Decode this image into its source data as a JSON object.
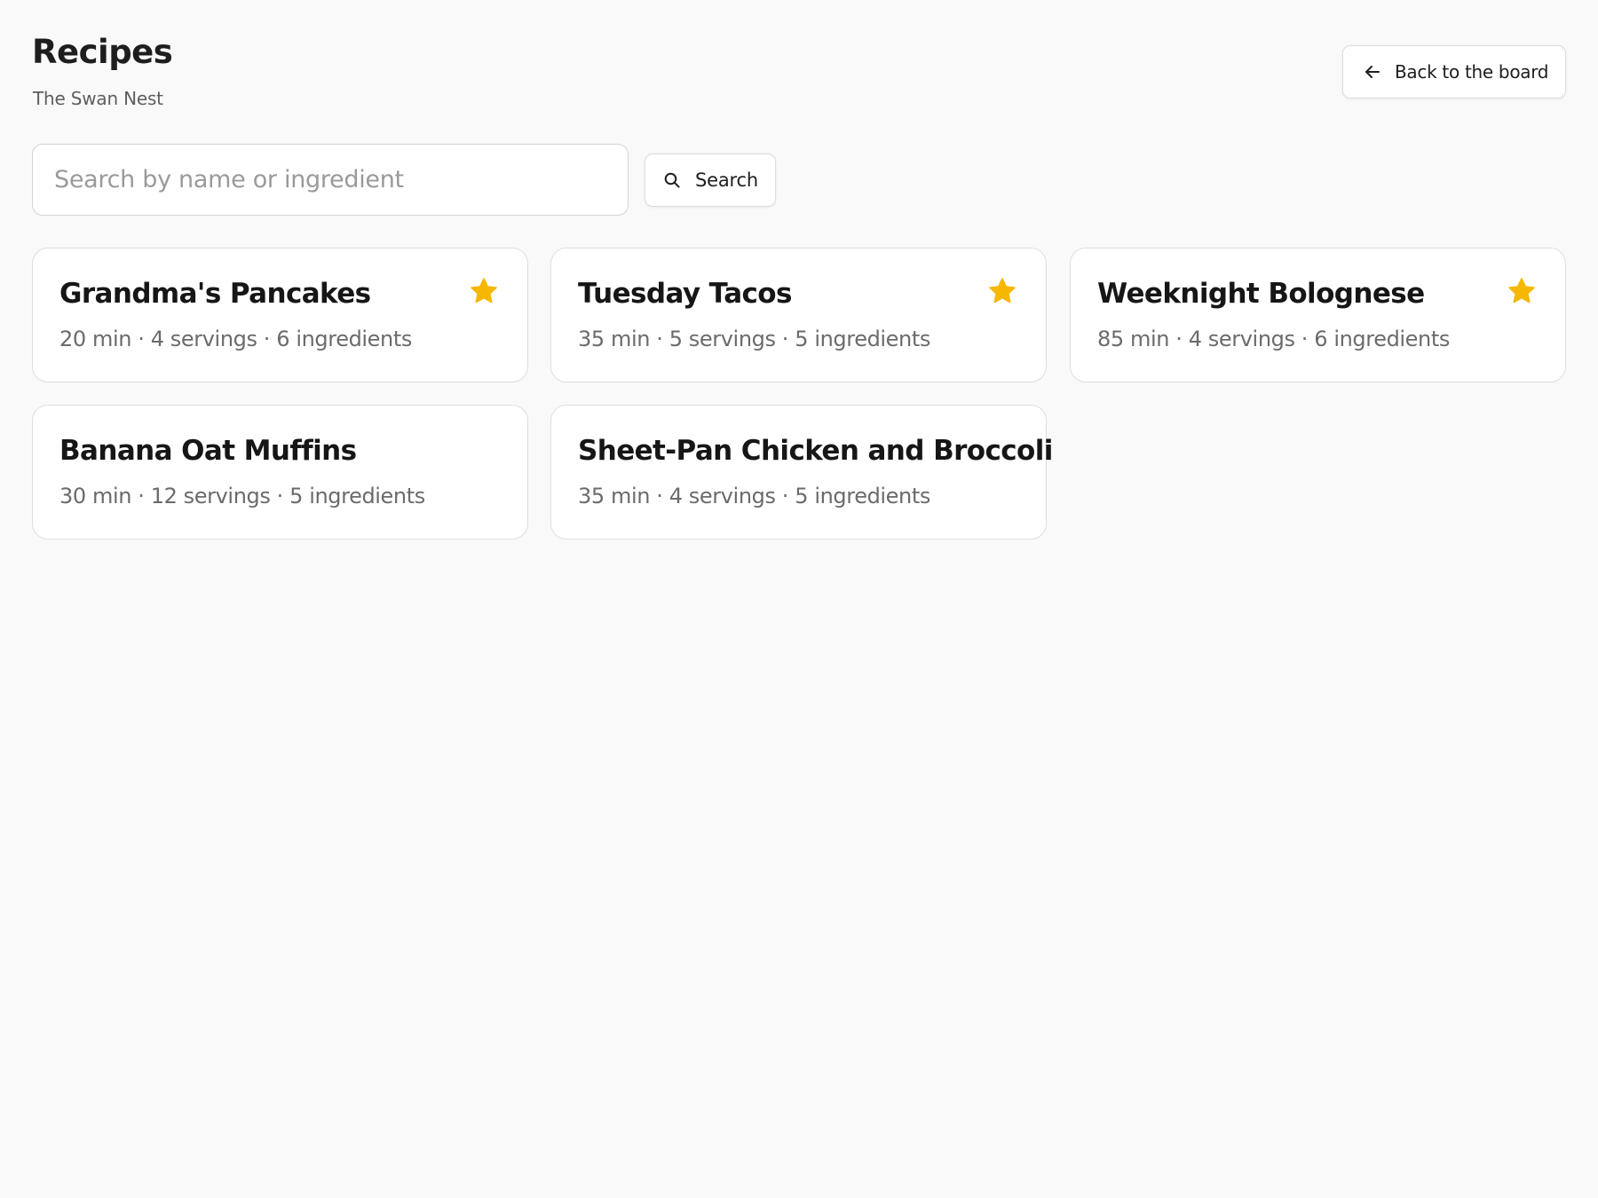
{
  "header": {
    "title": "Recipes",
    "subtitle": "The Swan Nest",
    "back_label": "Back to the board"
  },
  "search": {
    "placeholder": "Search by name or ingredient",
    "value": "",
    "button_label": "Search"
  },
  "colors": {
    "star": "#F5B700",
    "background": "#F9F9F9"
  },
  "icons": {
    "back": "arrow-left-icon",
    "search": "search-icon",
    "favorite": "star-icon"
  },
  "recipes": [
    {
      "title": "Grandma's Pancakes",
      "meta": "20 min · 4 servings · 6 ingredients",
      "favorite": true
    },
    {
      "title": "Tuesday Tacos",
      "meta": "35 min · 5 servings · 5 ingredients",
      "favorite": true
    },
    {
      "title": "Weeknight Bolognese",
      "meta": "85 min · 4 servings · 6 ingredients",
      "favorite": true
    },
    {
      "title": "Banana Oat Muffins",
      "meta": "30 min · 12 servings · 5 ingredients",
      "favorite": false
    },
    {
      "title": "Sheet-Pan Chicken and Broccoli",
      "meta": "35 min · 4 servings · 5 ingredients",
      "favorite": false
    }
  ]
}
